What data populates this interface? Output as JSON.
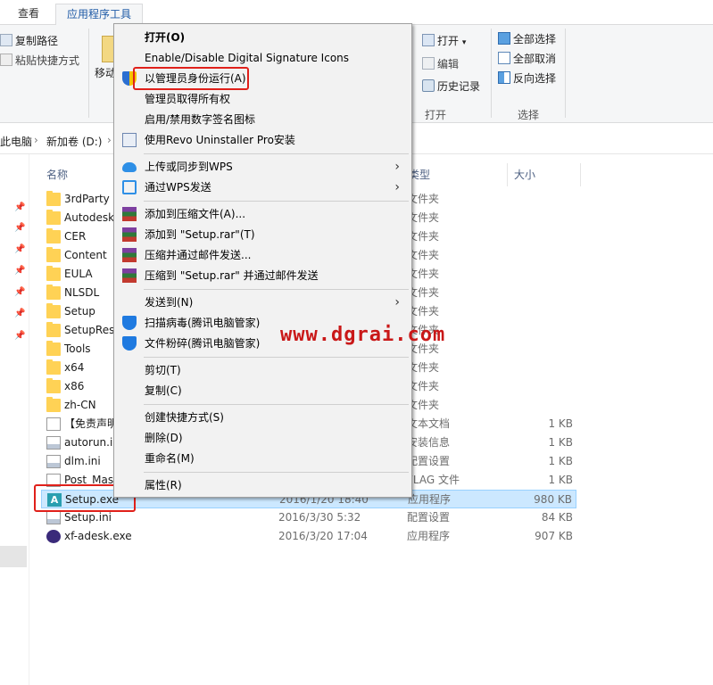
{
  "ribbon": {
    "tabs": [
      {
        "label": "查看"
      },
      {
        "label": "应用程序工具"
      }
    ],
    "copy_path": "复制路径",
    "paste_shortcut": "粘贴快捷方式",
    "move_label": "移动",
    "open_label": "打开",
    "edit_label": "编辑",
    "history_label": "历史记录",
    "open_group": "打开",
    "select_all": "全部选择",
    "select_none": "全部取消",
    "invert_selection": "反向选择",
    "select_group": "选择"
  },
  "address": {
    "crumbs": [
      "此电脑",
      "新加卷 (D:)"
    ],
    "separator": "›"
  },
  "columns": {
    "name": "名称",
    "type": "类型",
    "size": "大小"
  },
  "files": [
    {
      "name": "3rdParty",
      "date": "",
      "type": "文件夹",
      "size": "",
      "icon": "folder-icon"
    },
    {
      "name": "Autodesk",
      "date": "",
      "type": "文件夹",
      "size": "",
      "icon": "folder-icon"
    },
    {
      "name": "CER",
      "date": "",
      "type": "文件夹",
      "size": "",
      "icon": "folder-icon"
    },
    {
      "name": "Content",
      "date": "",
      "type": "文件夹",
      "size": "",
      "icon": "folder-icon"
    },
    {
      "name": "EULA",
      "date": "",
      "type": "文件夹",
      "size": "",
      "icon": "folder-icon"
    },
    {
      "name": "NLSDL",
      "date": "",
      "type": "文件夹",
      "size": "",
      "icon": "folder-icon"
    },
    {
      "name": "Setup",
      "date": "",
      "type": "文件夹",
      "size": "",
      "icon": "folder-icon"
    },
    {
      "name": "SetupRes",
      "date": "",
      "type": "文件夹",
      "size": "",
      "icon": "folder-icon"
    },
    {
      "name": "Tools",
      "date": "",
      "type": "文件夹",
      "size": "",
      "icon": "folder-icon"
    },
    {
      "name": "x64",
      "date": "",
      "type": "文件夹",
      "size": "",
      "icon": "folder-icon"
    },
    {
      "name": "x86",
      "date": "",
      "type": "文件夹",
      "size": "",
      "icon": "folder-icon"
    },
    {
      "name": "zh-CN",
      "date": "",
      "type": "文件夹",
      "size": "",
      "icon": "folder-icon"
    },
    {
      "name": "【免责声明",
      "date": "",
      "type": "文本文档",
      "size": "1 KB",
      "icon": "text-file-icon"
    },
    {
      "name": "autorun.in",
      "date": "",
      "type": "安装信息",
      "size": "1 KB",
      "icon": "ini-file-icon"
    },
    {
      "name": "dlm.ini",
      "date": "",
      "type": "配置设置",
      "size": "1 KB",
      "icon": "ini-file-icon"
    },
    {
      "name": "Post_Mas",
      "date": "",
      "type": "FLAG 文件",
      "size": "1 KB",
      "icon": "blank-file-icon"
    },
    {
      "name": "Setup.exe",
      "date": "2016/1/20 18:40",
      "type": "应用程序",
      "size": "980 KB",
      "icon": "autodesk-app-icon",
      "selected": true
    },
    {
      "name": "Setup.ini",
      "date": "2016/3/30 5:32",
      "type": "配置设置",
      "size": "84 KB",
      "icon": "ini-file-icon"
    },
    {
      "name": "xf-adesk.exe",
      "date": "2016/3/20 17:04",
      "type": "应用程序",
      "size": "907 KB",
      "icon": "keygen-app-icon"
    }
  ],
  "context_menu": {
    "items": [
      {
        "label": "打开(O)",
        "bold": true,
        "icon": ""
      },
      {
        "label": "Enable/Disable Digital Signature Icons",
        "icon": ""
      },
      {
        "label": "以管理员身份运行(A)",
        "icon": "uac-shield-icon"
      },
      {
        "label": "管理员取得所有权",
        "icon": ""
      },
      {
        "label": "启用/禁用数字签名图标",
        "icon": ""
      },
      {
        "label": "使用Revo Uninstaller Pro安装",
        "icon": "revo-icon"
      },
      {
        "sep": true
      },
      {
        "label": "上传或同步到WPS",
        "icon": "wps-cloud-icon",
        "submenu": true
      },
      {
        "label": "通过WPS发送",
        "icon": "wps-share-icon",
        "submenu": true
      },
      {
        "sep": true
      },
      {
        "label": "添加到压缩文件(A)...",
        "icon": "winrar-icon"
      },
      {
        "label": "添加到 \"Setup.rar\"(T)",
        "icon": "winrar-icon"
      },
      {
        "label": "压缩并通过邮件发送...",
        "icon": "winrar-icon"
      },
      {
        "label": "压缩到 \"Setup.rar\" 并通过邮件发送",
        "icon": "winrar-icon"
      },
      {
        "sep": true
      },
      {
        "label": "发送到(N)",
        "icon": "",
        "submenu": true
      },
      {
        "label": "扫描病毒(腾讯电脑管家)",
        "icon": "tencent-shield-icon"
      },
      {
        "label": "文件粉碎(腾讯电脑管家)",
        "icon": "tencent-shield-icon"
      },
      {
        "sep": true
      },
      {
        "label": "剪切(T)",
        "icon": ""
      },
      {
        "label": "复制(C)",
        "icon": ""
      },
      {
        "sep": true
      },
      {
        "label": "创建快捷方式(S)",
        "icon": ""
      },
      {
        "label": "删除(D)",
        "icon": ""
      },
      {
        "label": "重命名(M)",
        "icon": ""
      },
      {
        "sep": true
      },
      {
        "label": "属性(R)",
        "icon": ""
      }
    ]
  },
  "watermark": "www.dgrai.com",
  "colors": {
    "highlight_box": "#e0201a",
    "selection": "#cce8ff",
    "accent": "#1e5aa6"
  }
}
